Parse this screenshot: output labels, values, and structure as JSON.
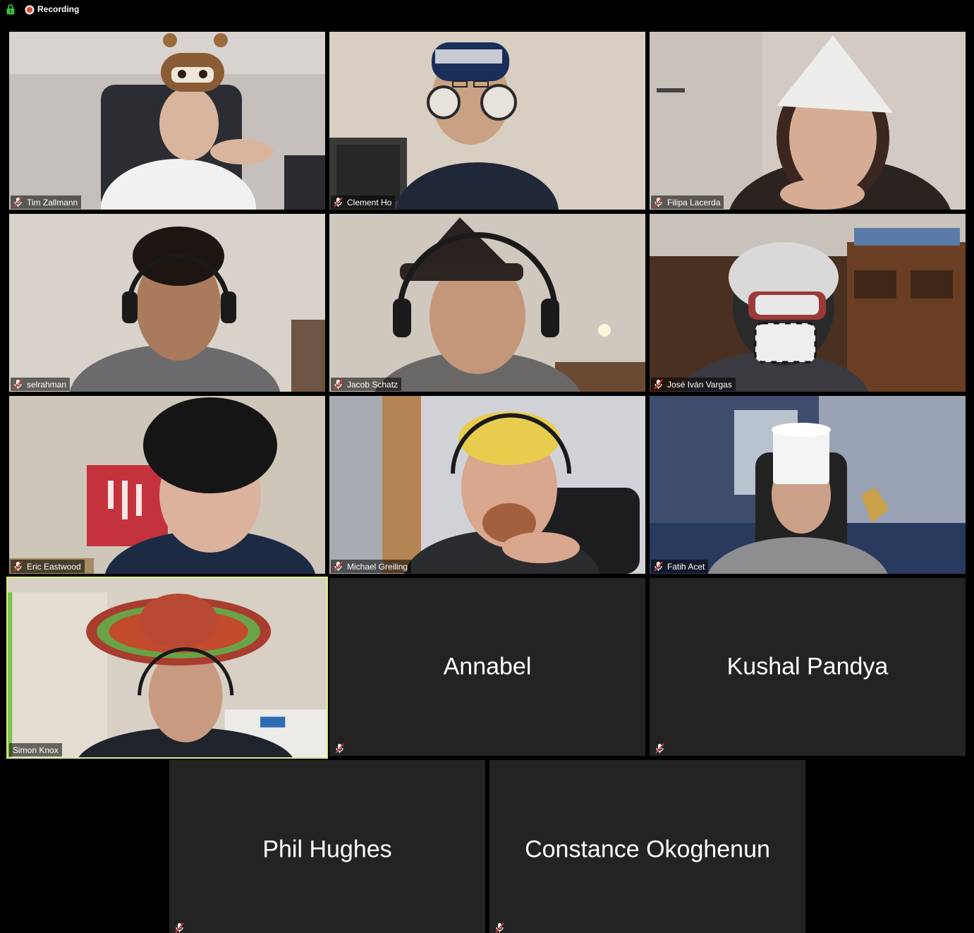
{
  "status_bar": {
    "recording_label": "Recording",
    "lock_icon": "lock-icon",
    "recording_icon": "recording-dot-icon"
  },
  "colors": {
    "background": "#000000",
    "tile_background": "#232323",
    "active_speaker_border": "#d9eb8c",
    "lock_green": "#3bbd3b",
    "recording_red": "#e0463c",
    "mute_red": "#e63b2e"
  },
  "participants": [
    {
      "name": "Tim Zallmann",
      "video": true,
      "muted": true,
      "active": false
    },
    {
      "name": "Clement Ho",
      "video": true,
      "muted": true,
      "active": false
    },
    {
      "name": "Filipa Lacerda",
      "video": true,
      "muted": true,
      "active": false
    },
    {
      "name": "selrahman",
      "video": true,
      "muted": true,
      "active": false
    },
    {
      "name": "Jacob Schatz",
      "video": true,
      "muted": true,
      "active": false
    },
    {
      "name": "José Iván Vargas",
      "video": true,
      "muted": true,
      "active": false
    },
    {
      "name": "Eric Eastwood",
      "video": true,
      "muted": true,
      "active": false
    },
    {
      "name": "Michael Greiling",
      "video": true,
      "muted": true,
      "active": false
    },
    {
      "name": "Fatih Acet",
      "video": true,
      "muted": true,
      "active": false
    },
    {
      "name": "Simon Knox",
      "video": true,
      "muted": false,
      "active": true
    },
    {
      "name": "Annabel",
      "video": false,
      "muted": true,
      "active": false
    },
    {
      "name": "Kushal Pandya",
      "video": false,
      "muted": true,
      "active": false
    },
    {
      "name": "Phil Hughes",
      "video": false,
      "muted": true,
      "active": false
    },
    {
      "name": "Constance Okoghenun",
      "video": false,
      "muted": true,
      "active": false
    }
  ]
}
